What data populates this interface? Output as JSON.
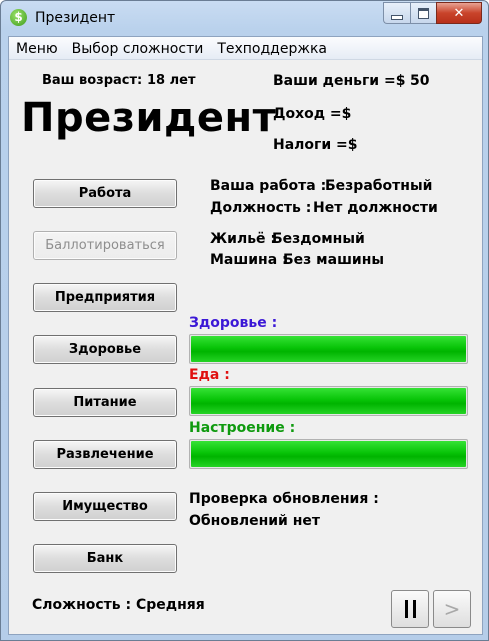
{
  "window": {
    "title": "Президент",
    "app_icon_glyph": "$"
  },
  "menu": [
    "Меню",
    "Выбор сложности",
    "Техподдержка"
  ],
  "stats": {
    "age_label": "Ваш возраст:",
    "age_value": "18 лет",
    "money_label": "Ваши деньги =$",
    "money_value": "50",
    "income_label": "Доход =$",
    "taxes_label": "Налоги =$"
  },
  "heading": "Президент",
  "buttons": {
    "work": "Работа",
    "elect": "Баллотироваться",
    "business": "Предприятия",
    "health": "Здоровье",
    "food": "Питание",
    "fun": "Развлечение",
    "property": "Имущество",
    "bank": "Банк"
  },
  "status": {
    "job_label": "Ваша работа :",
    "job_value": "Безработный",
    "position_label": "Должность :",
    "position_value": "Нет должности",
    "housing_label": "Жильё :",
    "housing_value": "Бездомный",
    "car_label": "Машина :",
    "car_value": "Без машины"
  },
  "meters": {
    "health": {
      "label": "Здоровье :",
      "color": "#3b18d6",
      "percent": 100
    },
    "food": {
      "label": "Еда :",
      "color": "#e01010",
      "percent": 100
    },
    "mood": {
      "label": "Настроение :",
      "color": "#0f9a0f",
      "percent": 100
    }
  },
  "update": {
    "line1": "Проверка обновления :",
    "line2": "Обновлений нет"
  },
  "difficulty": {
    "label": "Сложность :",
    "value": "Средняя"
  },
  "controls": {
    "pause_icon": "pause-icon",
    "play_icon": "play-icon",
    "play_glyph": ">"
  },
  "window_buttons": {
    "close_glyph": "✕"
  }
}
